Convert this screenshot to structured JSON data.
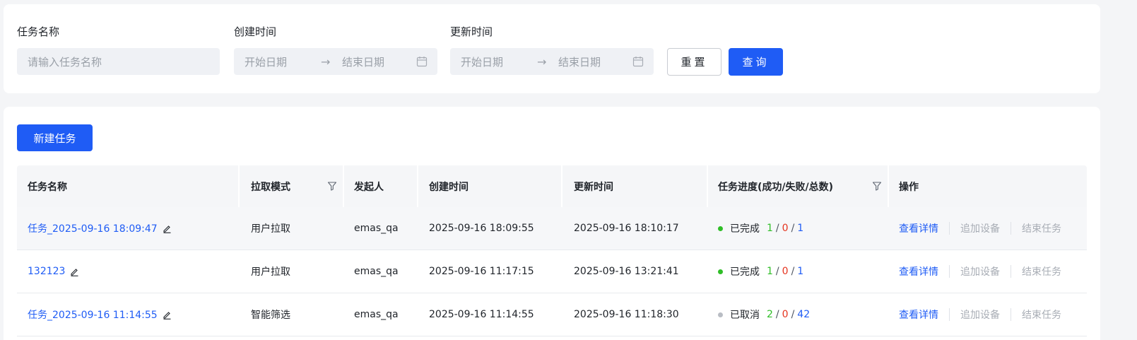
{
  "filters": {
    "name": {
      "label": "任务名称",
      "placeholder": "请输入任务名称"
    },
    "created": {
      "label": "创建时间",
      "start_placeholder": "开始日期",
      "end_placeholder": "结束日期",
      "separator": "→"
    },
    "updated": {
      "label": "更新时间",
      "start_placeholder": "开始日期",
      "end_placeholder": "结束日期",
      "separator": "→"
    },
    "reset_label": "重置",
    "query_label": "查询"
  },
  "toolbar": {
    "new_task_label": "新建任务"
  },
  "table": {
    "columns": {
      "name": "任务名称",
      "mode": "拉取模式",
      "initiator": "发起人",
      "created": "创建时间",
      "updated": "更新时间",
      "progress": "任务进度(成功/失败/总数)",
      "actions": "操作"
    },
    "rows": [
      {
        "name": "任务_2025-09-16 18:09:47",
        "mode": "用户拉取",
        "initiator": "emas_qa",
        "created": "2025-09-16 18:09:55",
        "updated": "2025-09-16 18:10:17",
        "status": "已完成",
        "status_type": "done",
        "success": "1",
        "fail": "0",
        "total": "1"
      },
      {
        "name": "132123",
        "mode": "用户拉取",
        "initiator": "emas_qa",
        "created": "2025-09-16 11:17:15",
        "updated": "2025-09-16 13:21:41",
        "status": "已完成",
        "status_type": "done",
        "success": "1",
        "fail": "0",
        "total": "1"
      },
      {
        "name": "任务_2025-09-16 11:14:55",
        "mode": "智能筛选",
        "initiator": "emas_qa",
        "created": "2025-09-16 11:14:55",
        "updated": "2025-09-16 11:18:30",
        "status": "已取消",
        "status_type": "cancel",
        "success": "2",
        "fail": "0",
        "total": "42"
      }
    ],
    "actions": {
      "detail": "查看详情",
      "add_device": "追加设备",
      "end_task": "结束任务"
    },
    "slash": "/"
  },
  "colors": {
    "primary": "#1f5cf5",
    "success": "#2fbe27",
    "fail": "#e5341f",
    "muted": "#a8adb5"
  }
}
